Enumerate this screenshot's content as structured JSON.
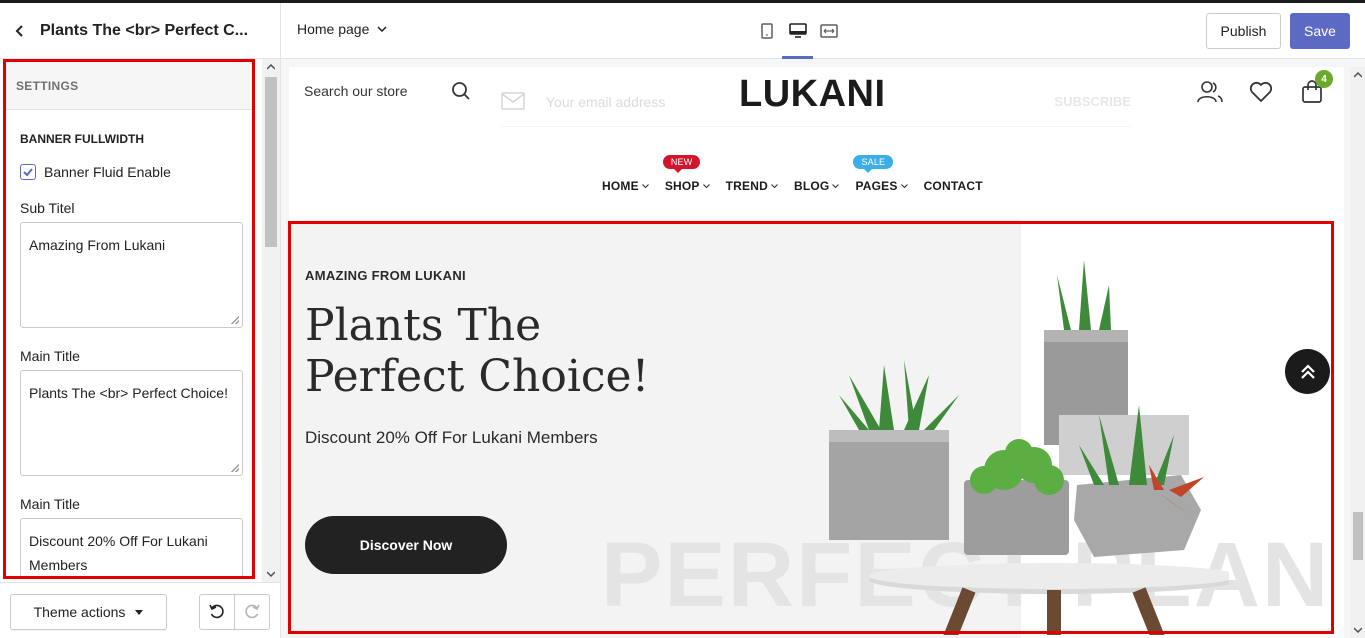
{
  "editor": {
    "section_title": "Plants The <br> Perfect C...",
    "settings_heading": "SETTINGS",
    "group_heading": "BANNER FULLWIDTH",
    "checkbox_label": "Banner Fluid Enable",
    "checkbox_checked": true,
    "fields": [
      {
        "label": "Sub Titel",
        "value": "Amazing From Lukani"
      },
      {
        "label": "Main Title",
        "value": "Plants The <br> Perfect Choice!"
      },
      {
        "label": "Main Title",
        "value": "Discount 20% Off For Lukani Members"
      }
    ],
    "theme_actions_label": "Theme actions"
  },
  "toolbar": {
    "page_select": "Home page",
    "publish_label": "Publish",
    "save_label": "Save",
    "accent_color": "#5c6ac4"
  },
  "store": {
    "search_placeholder": "Search our store",
    "newsletter_placeholder": "Your email address",
    "newsletter_button": "SUBSCRIBE",
    "logo": "LUKANI",
    "cart_count": "4",
    "nav": [
      {
        "label": "HOME",
        "dropdown": true,
        "badge": ""
      },
      {
        "label": "SHOP",
        "dropdown": true,
        "badge": "NEW"
      },
      {
        "label": "TREND",
        "dropdown": true,
        "badge": ""
      },
      {
        "label": "BLOG",
        "dropdown": true,
        "badge": ""
      },
      {
        "label": "PAGES",
        "dropdown": true,
        "badge": "SALE"
      },
      {
        "label": "CONTACT",
        "dropdown": false,
        "badge": ""
      }
    ],
    "banner": {
      "subtitle": "AMAZING FROM LUKANI",
      "title_line1": "Plants The",
      "title_line2": "Perfect Choice!",
      "discount": "Discount 20% Off For Lukani Members",
      "button_label": "Discover Now",
      "watermark": "PERFECT PLAN"
    }
  },
  "colors": {
    "highlight_outline": "#e00000",
    "badge_new": "#d3152b",
    "badge_sale": "#3baee8",
    "cart_badge": "#6ca82b"
  }
}
